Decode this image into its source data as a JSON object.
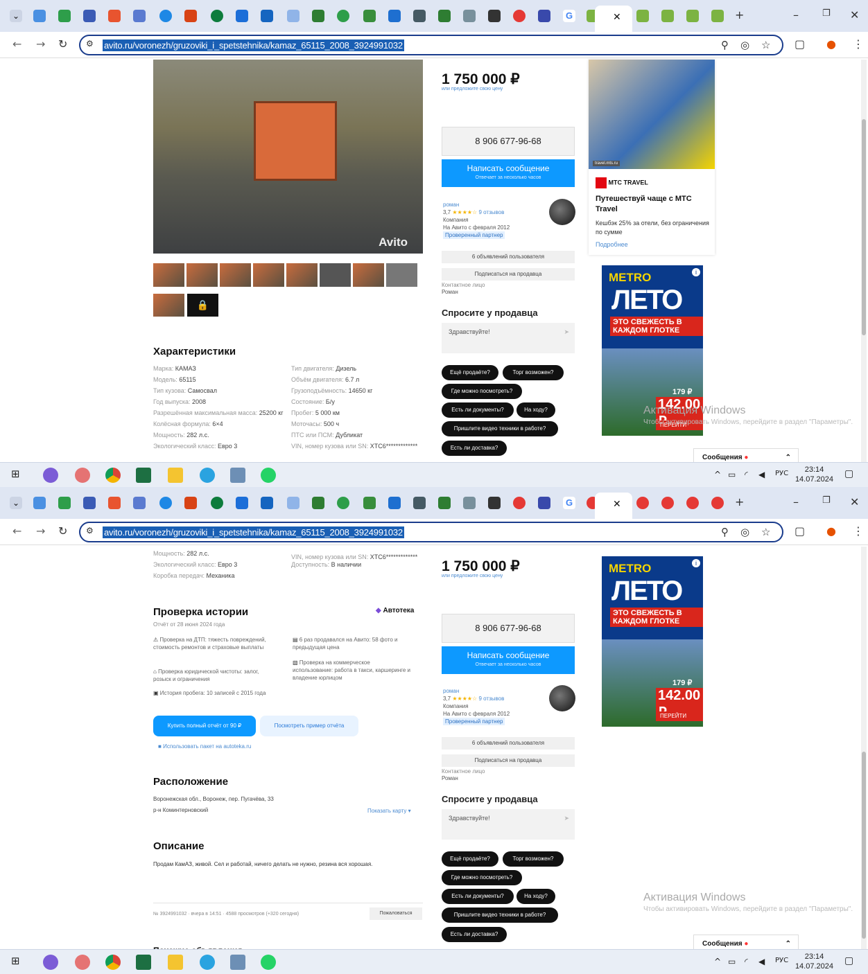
{
  "browser": {
    "url": "avito.ru/voronezh/gruzoviki_i_spetstehnika/kamaz_65115_2008_3924991032"
  },
  "taskbar": {
    "lang": "РУС",
    "time": "23:14",
    "date": "14.07.2024"
  },
  "listing": {
    "price": "1 750 000 ₽",
    "offer": "или предложите свою цену",
    "phone": "8 906 677-96-68",
    "write": "Написать сообщение",
    "write_sub": "Отвечает за несколько часов",
    "seller_name": "роман",
    "rating": "3,7",
    "reviews": "9 отзывов",
    "seller_type": "Компания",
    "since": "На Авито с февраля 2012",
    "verified": "Проверенный партнер",
    "ads_count": "6 объявлений пользователя",
    "subscribe": "Подписаться на продавца",
    "contact_label": "Контактное лицо",
    "contact_name": "Роман",
    "ask_title": "Спросите у продавца",
    "ask_placeholder": "Здравствуйте!",
    "chips": [
      "Ещё продаёте?",
      "Торг возможен?",
      "Где можно посмотреть?",
      "Есть ли документы?",
      "На ходу?",
      "Пришлите видео техники в работе?",
      "Есть ли доставка?"
    ],
    "watermark": "Avito"
  },
  "specs": {
    "title": "Характеристики",
    "left": [
      [
        "Марка",
        "КАМАЗ"
      ],
      [
        "Модель",
        "65115"
      ],
      [
        "Тип кузова",
        "Самосвал"
      ],
      [
        "Год выпуска",
        "2008"
      ],
      [
        "Разрешённая максимальная масса",
        "25200 кг"
      ],
      [
        "Колёсная формула",
        "6×4"
      ],
      [
        "Мощность",
        "282 л.с."
      ],
      [
        "Экологический класс",
        "Евро 3"
      ]
    ],
    "right": [
      [
        "Тип двигателя",
        "Дизель"
      ],
      [
        "Объём двигателя",
        "6.7 л"
      ],
      [
        "Грузоподъёмность",
        "14650 кг"
      ],
      [
        "Состояние",
        "Б/у"
      ],
      [
        "Пробег",
        "5 000 км"
      ],
      [
        "Моточасы",
        "500 ч"
      ],
      [
        "ПТС или ПСМ",
        "Дубликат"
      ],
      [
        "VIN, номер кузова или SN",
        "XTC6*************"
      ]
    ],
    "extra_left": [
      [
        "Мощность",
        "282 л.с."
      ],
      [
        "Экологический класс",
        "Евро 3"
      ],
      [
        "Коробка передач",
        "Механика"
      ]
    ],
    "extra_right": [
      [
        "VIN, номер кузова или SN",
        "XTC6*************"
      ],
      [
        "Доступность",
        "В наличии"
      ]
    ]
  },
  "history": {
    "title": "Проверка истории",
    "brand": "Автотека",
    "date": "Отчёт от 28 июня 2024 года",
    "items": [
      "Проверка на ДТП: тяжесть повреждений, стоимость ремонтов и страховые выплаты",
      "Проверка юридической чистоты: залог, розыск и ограничения",
      "История пробега: 10 записей с 2015 года"
    ],
    "items_right": [
      "6 раз продавался на Авито: 58 фото и предыдущая цена",
      "Проверка на коммерческое использование: работа в такси, каршеринге и владение юрлицом"
    ],
    "buy": "Купить полный отчёт от 90 ₽",
    "example": "Посмотреть пример отчёта",
    "package": "Использовать пакет на autoteka.ru"
  },
  "location": {
    "title": "Расположение",
    "address": "Воронежская обл., Воронеж, пер. Пугачёва, 33",
    "district": "р-н Коминтерновский",
    "map": "Показать карту"
  },
  "description": {
    "title": "Описание",
    "text": "Продам КамАЗ, живой. Сел и работай, ничего делать не нужно, резина вся хорошая.",
    "meta": "№ 3924991032 · вчера в 14:51 · 4588 просмотров (+320 сегодня)",
    "report": "Пожаловаться",
    "similar": "Похожие объявления"
  },
  "ads": {
    "travel_tag": "travel.mts.ru",
    "travel_brand": "МТС TRAVEL",
    "travel_title": "Путешествуй чаще с МТС Travel",
    "travel_text": "Кешбэк 25% за отели, без ограничения по сумме",
    "travel_more": "Подробнее",
    "metro_logo": "METRO",
    "metro_title": "ЛЕТО",
    "metro_slogan": "ЭТО СВЕЖЕСТЬ В КАЖДОМ ГЛОТКЕ",
    "metro_price": "142.00 ₽",
    "metro_old": "179 ₽",
    "metro_go": "ПЕРЕЙТИ"
  },
  "system": {
    "activate": "Активация Windows",
    "activate_sub": "Чтобы активировать Windows, перейдите в раздел \"Параметры\".",
    "messages": "Сообщения"
  }
}
